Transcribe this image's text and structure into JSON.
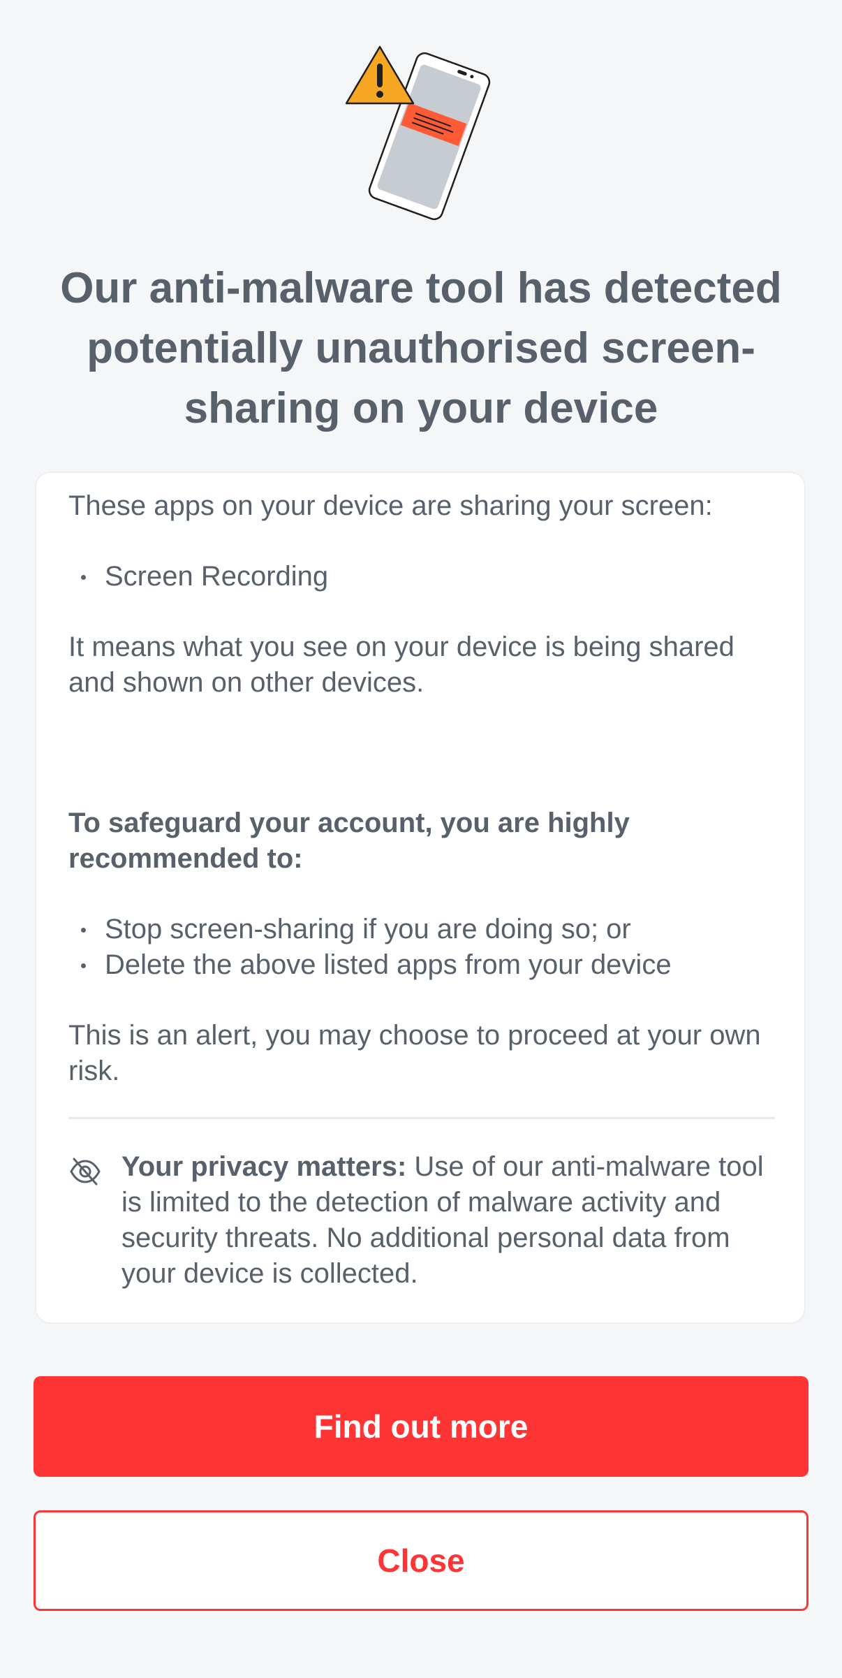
{
  "illustration": {
    "name": "phone-warning-illustration",
    "warning_color": "#f5a623",
    "alert_bar_color": "#ff5a36"
  },
  "alert": {
    "title": "Our anti-malware tool has detected potentially unauthorised screen-sharing on your device"
  },
  "card": {
    "intro": "These apps on your device are sharing your screen:",
    "apps": [
      "Screen Recording"
    ],
    "meaning": "It means what you see on your device is being shared and shown on other devices.",
    "recommend_heading": "To safeguard your account, you are highly recommended to:",
    "recommendations": [
      "Stop screen-sharing if you are doing so; or",
      "Delete the above listed apps from your device"
    ],
    "risk_note": "This is an alert, you may choose to proceed at your own risk."
  },
  "privacy": {
    "icon": "eye-off-icon",
    "label": "Your privacy matters:",
    "text": " Use of our anti-malware tool is limited to the detection of malware activity and security threats. No additional personal data from your device is collected."
  },
  "actions": {
    "primary_label": "Find out more",
    "secondary_label": "Close"
  },
  "colors": {
    "background": "#f5f6f8",
    "text": "#58616b",
    "accent": "#ff3535"
  }
}
